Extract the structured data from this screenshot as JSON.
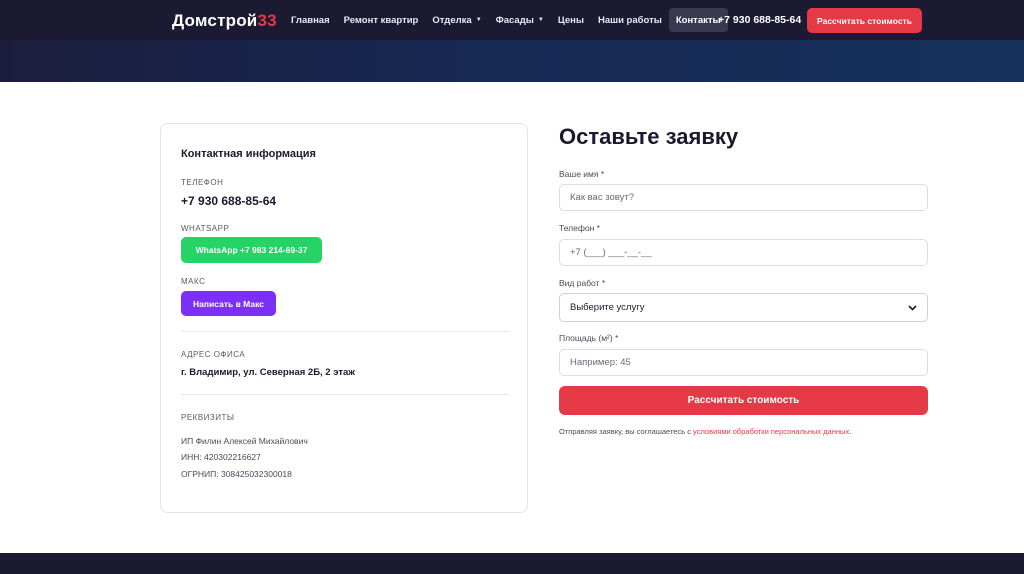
{
  "header": {
    "logo_main": "Домстрой",
    "logo_accent": "33",
    "nav": [
      {
        "label": "Главная"
      },
      {
        "label": "Ремонт квартир"
      },
      {
        "label": "Отделка",
        "caret": "▼"
      },
      {
        "label": "Фасады",
        "caret": "▼"
      },
      {
        "label": "Цены"
      },
      {
        "label": "Наши работы"
      },
      {
        "label": "Контакты"
      }
    ],
    "phone": "+7 930 688-85-64",
    "cta_label": "Рассчитать стоимость"
  },
  "contact": {
    "title": "Контактная информация",
    "phone_label": "ТЕЛЕФОН",
    "phone_value": "+7 930 688-85-64",
    "whatsapp_label": "WHATSAPP",
    "whatsapp_button": "WhatsApp +7 983 214-69-37",
    "max_label": "МАКС",
    "max_button": "Написать в Макс",
    "address_label": "АДРЕС ОФИСА",
    "address_value": "г. Владимир, ул. Северная 2Б, 2 этаж",
    "requisites_label": "РЕКВИЗИТЫ",
    "requisites": [
      "ИП Филин Алексей Михайлович",
      "ИНН: 420302216627",
      "ОГРНИП: 308425032300018"
    ]
  },
  "form": {
    "title": "Оставьте заявку",
    "name_label": "Ваше имя *",
    "name_placeholder": "Как вас зовут?",
    "phone_label": "Телефон *",
    "phone_placeholder": "+7 (___) ___-__-__",
    "service_label": "Вид работ *",
    "service_selected": "Выберите услугу",
    "area_label": "Площадь (м²) *",
    "area_placeholder": "Например: 45",
    "submit_label": "Рассчитать стоимость",
    "consent_text": "Отправляя заявку, вы соглашаетесь с ",
    "consent_link": "условиями обработки персональных данных",
    "consent_end": "."
  },
  "colors": {
    "accent": "#e63946",
    "header_bg": "#1c1a33",
    "whatsapp": "#25d366",
    "max": "#7b2ff7"
  }
}
